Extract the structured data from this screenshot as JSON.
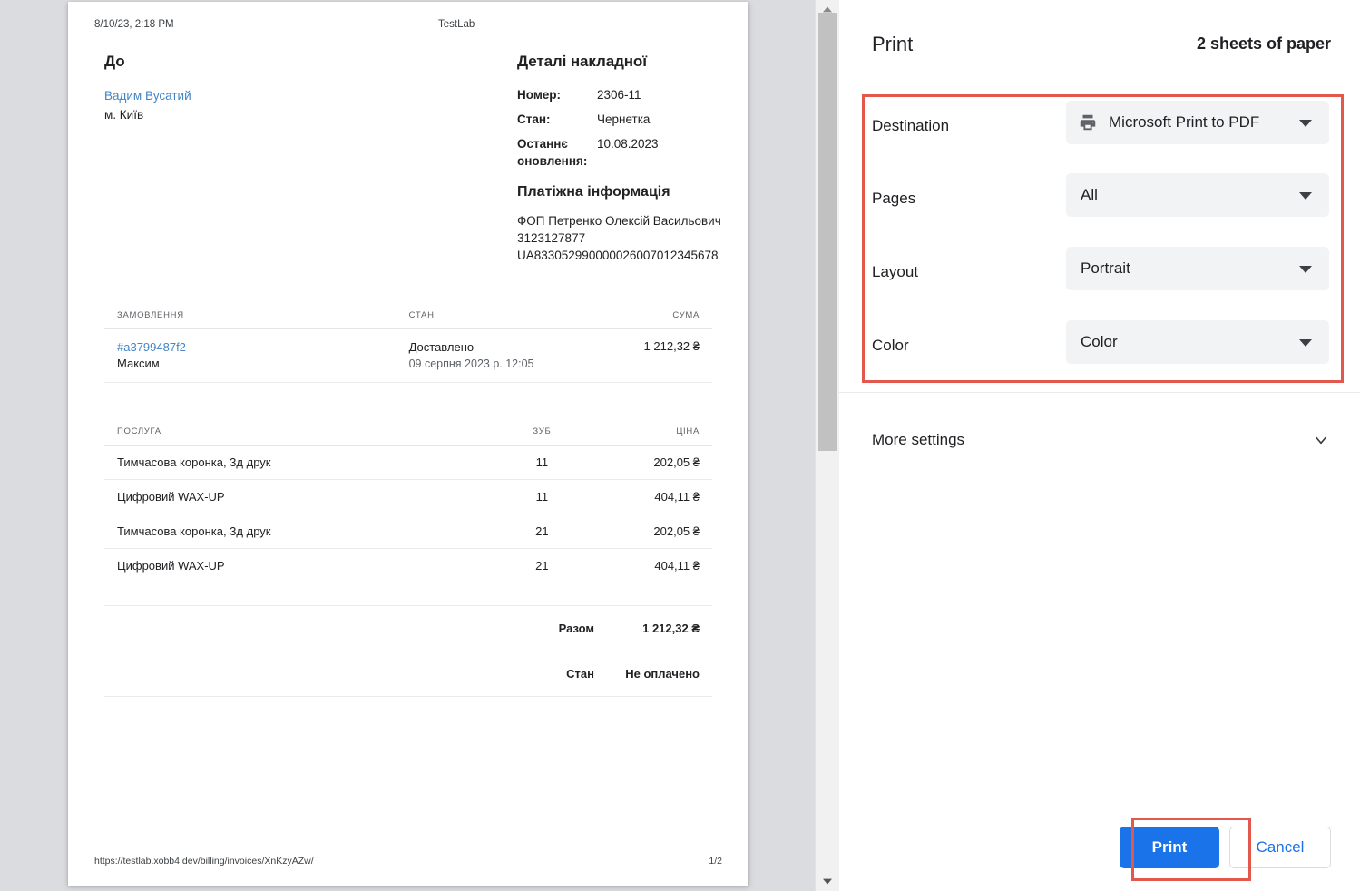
{
  "preview": {
    "page_header": {
      "date": "8/10/23, 2:18 PM",
      "brand": "TestLab"
    },
    "page_footer": {
      "url": "https://testlab.xobb4.dev/billing/invoices/XnKzyAZw/",
      "page_number": "1/2"
    },
    "to": {
      "title": "До",
      "name": "Вадим Вусатий",
      "city": "м. Київ"
    },
    "details": {
      "title": "Деталі накладної",
      "rows": [
        {
          "key": "Номер:",
          "value": "2306-11"
        },
        {
          "key": "Стан:",
          "value": "Чернетка"
        },
        {
          "key": "Останнє оновлення:",
          "value": "10.08.2023"
        }
      ],
      "payment_title": "Платіжна інформація",
      "payment_lines": [
        "ФОП Петренко Олексій Васильович",
        "3123127877",
        "UA833052990000026007012345678"
      ]
    },
    "orders_table": {
      "headers": [
        "ЗАМОВЛЕННЯ",
        "СТАН",
        "СУМА"
      ],
      "rows": [
        {
          "order_id": "#a3799487f2",
          "order_sub": "Максим",
          "state": "Доставлено",
          "state_date": "09 серпня 2023 р. 12:05",
          "amount": "1 212,32 ₴"
        }
      ]
    },
    "services_table": {
      "headers": [
        "ПОСЛУГА",
        "ЗУБ",
        "ЦІНА"
      ],
      "rows": [
        {
          "service": "Тимчасова коронка, 3д друк",
          "tooth": "11",
          "price": "202,05 ₴"
        },
        {
          "service": "Цифровий WAX-UP",
          "tooth": "11",
          "price": "404,11 ₴"
        },
        {
          "service": "Тимчасова коронка, 3д друк",
          "tooth": "21",
          "price": "202,05 ₴"
        },
        {
          "service": "Цифровий WAX-UP",
          "tooth": "21",
          "price": "404,11 ₴"
        }
      ]
    },
    "totals": [
      {
        "label": "Разом",
        "value": "1 212,32 ₴"
      },
      {
        "label": "Стан",
        "value": "Не оплачено"
      }
    ]
  },
  "print_dialog": {
    "title": "Print",
    "sheets": "2 sheets of paper",
    "settings": [
      {
        "label": "Destination",
        "value": "Microsoft Print to PDF",
        "icon": "printer-icon"
      },
      {
        "label": "Pages",
        "value": "All",
        "icon": ""
      },
      {
        "label": "Layout",
        "value": "Portrait",
        "icon": ""
      },
      {
        "label": "Color",
        "value": "Color",
        "icon": ""
      }
    ],
    "more_settings_label": "More settings",
    "buttons": {
      "print": "Print",
      "cancel": "Cancel"
    }
  },
  "colors": {
    "accent_blue": "#1a73e8",
    "link_blue": "#4285c5",
    "highlight_red": "#e2584d",
    "dropdown_bg": "#f1f3f4",
    "preview_bg": "#dadce0"
  }
}
